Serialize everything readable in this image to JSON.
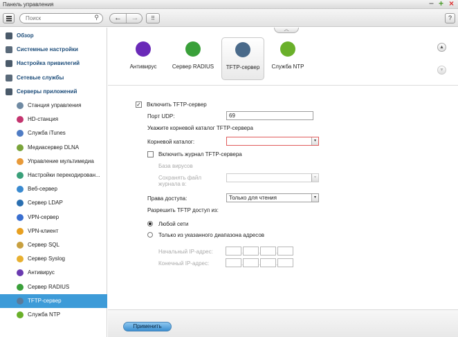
{
  "window": {
    "title": "Панель управления"
  },
  "toolbar": {
    "search_placeholder": "Поиск",
    "back": "←",
    "forward": "→",
    "grid": "⠿",
    "help": "?"
  },
  "sidebar": {
    "items": [
      {
        "label": "Обзор",
        "level": "top",
        "icon": "overview-icon",
        "color": "#4a5a6a"
      },
      {
        "label": "Системные настройки",
        "level": "top",
        "icon": "gear-icon",
        "color": "#5a6a7a"
      },
      {
        "label": "Настройка привилегий",
        "level": "top",
        "icon": "user-icon",
        "color": "#4a5a6a"
      },
      {
        "label": "Сетевые службы",
        "level": "top",
        "icon": "network-icon",
        "color": "#5a6a7a"
      },
      {
        "label": "Серверы приложений",
        "level": "top",
        "icon": "server-icon",
        "color": "#4a5a6a"
      },
      {
        "label": "Станция управления",
        "level": "sub",
        "icon": "station-icon",
        "color": "#6f8aa3"
      },
      {
        "label": "HD-станция",
        "level": "sub",
        "icon": "hd-station-icon",
        "color": "#c4356f"
      },
      {
        "label": "Служба iTunes",
        "level": "sub",
        "icon": "itunes-icon",
        "color": "#4f7cc4"
      },
      {
        "label": "Медиасервер DLNA",
        "level": "sub",
        "icon": "dlna-icon",
        "color": "#7aa43a"
      },
      {
        "label": "Управление мультимедиа",
        "level": "sub",
        "icon": "multimedia-icon",
        "color": "#e89a3a"
      },
      {
        "label": "Настройки перекодирован...",
        "level": "sub",
        "icon": "transcode-icon",
        "color": "#3aa07a"
      },
      {
        "label": "Веб-сервер",
        "level": "sub",
        "icon": "web-icon",
        "color": "#3a8ad0"
      },
      {
        "label": "Сервер LDAP",
        "level": "sub",
        "icon": "ldap-icon",
        "color": "#2a6fb0"
      },
      {
        "label": "VPN-сервер",
        "level": "sub",
        "icon": "vpn-server-icon",
        "color": "#3a6fd0"
      },
      {
        "label": "VPN-клиент",
        "level": "sub",
        "icon": "vpn-client-icon",
        "color": "#e8a020"
      },
      {
        "label": "Сервер SQL",
        "level": "sub",
        "icon": "sql-icon",
        "color": "#c8a040"
      },
      {
        "label": "Сервер Syslog",
        "level": "sub",
        "icon": "syslog-icon",
        "color": "#e8b030"
      },
      {
        "label": "Антивирус",
        "level": "sub",
        "icon": "antivirus-icon",
        "color": "#6a3ab0"
      },
      {
        "label": "Сервер RADIUS",
        "level": "sub",
        "icon": "radius-icon",
        "color": "#3aa03a"
      },
      {
        "label": "TFTP-сервер",
        "level": "sub",
        "icon": "tftp-icon",
        "color": "#5a7a9a",
        "active": true
      },
      {
        "label": "Служба NTP",
        "level": "sub",
        "icon": "ntp-icon",
        "color": "#6ab02a"
      }
    ]
  },
  "services": [
    {
      "label": "Антивирус",
      "icon": "antivirus-icon",
      "color": "#6a2ab8"
    },
    {
      "label": "Сервер RADIUS",
      "icon": "radius-icon",
      "color": "#3aa03a"
    },
    {
      "label": "TFTP-сервер",
      "icon": "tftp-icon",
      "color": "#4a6a8a",
      "selected": true
    },
    {
      "label": "Служба NTP",
      "icon": "ntp-icon",
      "color": "#6ab02a"
    }
  ],
  "form": {
    "enable_label": "Включить TFTP-сервер",
    "enable_checked": "✓",
    "udp_label": "Порт UDP:",
    "udp_value": "69",
    "root_hint": "Укажите корневой каталог TFTP-сервера",
    "root_label": "Корневой каталог:",
    "root_value": "",
    "log_label": "Включить журнал TFTP-сервера",
    "db_label": "База вирусов",
    "save_label": "Сохранять файл журнала в:",
    "save_value": "",
    "access_label": "Права доступа:",
    "access_value": "Только для чтения",
    "allow_label": "Разрешить TFTP доступ из:",
    "any_network": "Любой сети",
    "range_only": "Только из указанного диапазона адресов",
    "start_ip": "Начальный IP-адрес:",
    "end_ip": "Конечный IP-адрес:",
    "dropdown_arrow": "▾"
  },
  "bottom": {
    "apply": "Применить"
  }
}
